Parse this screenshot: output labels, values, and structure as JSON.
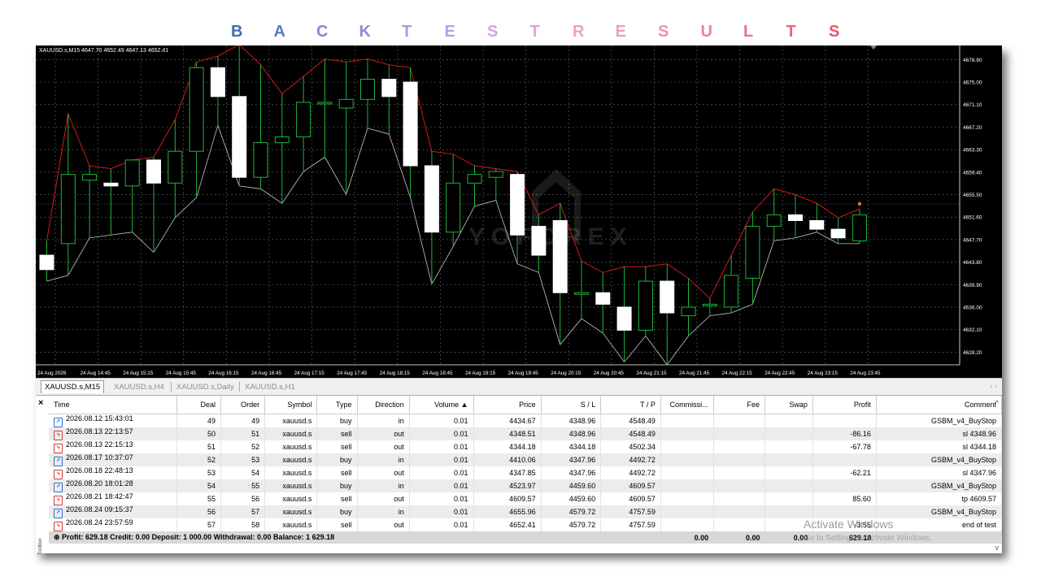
{
  "banner": {
    "letters": [
      "B",
      "A",
      "C",
      "K",
      "T",
      "E",
      "S",
      "T",
      "R",
      "E",
      "S",
      "U",
      "L",
      "T",
      "S"
    ],
    "colors": [
      "#3f6fb3",
      "#5a7bc4",
      "#7a8fd0",
      "#8b8bd8",
      "#a59be0",
      "#b69ee0",
      "#d3a3e6",
      "#e1a3d8",
      "#e8a3c8",
      "#ed9eb8",
      "#ef93aa",
      "#ee8294",
      "#ed7086",
      "#ec6178",
      "#e8566e"
    ]
  },
  "chart": {
    "header": "XAUUSD.s,M15  4647.70 4652.49 4647.13 4652.41",
    "watermark": "YOFOREX",
    "price_labels": [
      "4678.90",
      "4675.00",
      "4671.10",
      "4667.20",
      "4663.30",
      "4659.40",
      "4655.50",
      "4651.60",
      "4647.70",
      "4643.80",
      "4639.90",
      "4636.00",
      "4632.10",
      "4628.20"
    ],
    "time_labels": [
      "24 Aug 2026",
      "24 Aug 14:45",
      "24 Aug 15:15",
      "24 Aug 15:45",
      "24 Aug 16:15",
      "24 Aug 16:45",
      "24 Aug 17:15",
      "24 Aug 17:45",
      "24 Aug 18:15",
      "24 Aug 18:45",
      "24 Aug 19:15",
      "24 Aug 19:45",
      "24 Aug 20:15",
      "24 Aug 20:45",
      "24 Aug 21:15",
      "24 Aug 21:45",
      "24 Aug 22:15",
      "24 Aug 22:45",
      "24 Aug 23:15",
      "24 Aug 23:45"
    ],
    "candles": [
      {
        "o": 4645.0,
        "c": 4642.5,
        "h": 4647.5,
        "l": 4640.5
      },
      {
        "o": 4647.0,
        "c": 4659.0,
        "h": 4669.5,
        "l": 4641.5
      },
      {
        "o": 4658.0,
        "c": 4659.0,
        "h": 4660.5,
        "l": 4648.0
      },
      {
        "o": 4657.5,
        "c": 4657.0,
        "h": 4660.0,
        "l": 4648.5
      },
      {
        "o": 4657.0,
        "c": 4661.5,
        "h": 4661.5,
        "l": 4649.0
      },
      {
        "o": 4661.5,
        "c": 4657.5,
        "h": 4662.0,
        "l": 4645.5
      },
      {
        "o": 4657.5,
        "c": 4663.0,
        "h": 4668.5,
        "l": 4651.5
      },
      {
        "o": 4663.0,
        "c": 4677.5,
        "h": 4678.5,
        "l": 4655.0
      },
      {
        "o": 4677.5,
        "c": 4672.5,
        "h": 4679.5,
        "l": 4667.5
      },
      {
        "o": 4672.5,
        "c": 4658.5,
        "h": 4681.5,
        "l": 4657.0
      },
      {
        "o": 4658.5,
        "c": 4664.5,
        "h": 4678.0,
        "l": 4656.5
      },
      {
        "o": 4664.5,
        "c": 4665.5,
        "h": 4673.0,
        "l": 4654.0
      },
      {
        "o": 4665.5,
        "c": 4671.5,
        "h": 4676.0,
        "l": 4659.5
      },
      {
        "o": 4671.5,
        "c": 4671.5,
        "h": 4679.0,
        "l": 4662.0
      },
      {
        "o": 4670.5,
        "c": 4672.0,
        "h": 4678.5,
        "l": 4655.5
      },
      {
        "o": 4672.0,
        "c": 4675.5,
        "h": 4679.0,
        "l": 4667.0
      },
      {
        "o": 4675.5,
        "c": 4672.5,
        "h": 4678.0,
        "l": 4666.0
      },
      {
        "o": 4675.0,
        "c": 4660.5,
        "h": 4677.5,
        "l": 4655.0
      },
      {
        "o": 4660.5,
        "c": 4649.0,
        "h": 4663.0,
        "l": 4640.0
      },
      {
        "o": 4649.0,
        "c": 4657.5,
        "h": 4662.5,
        "l": 4646.5
      },
      {
        "o": 4657.5,
        "c": 4659.0,
        "h": 4660.5,
        "l": 4653.5
      },
      {
        "o": 4658.5,
        "c": 4659.5,
        "h": 4660.0,
        "l": 4654.5
      },
      {
        "o": 4659.0,
        "c": 4648.5,
        "h": 4659.5,
        "l": 4643.5
      },
      {
        "o": 4650.0,
        "c": 4645.0,
        "h": 4652.0,
        "l": 4642.0
      },
      {
        "o": 4651.0,
        "c": 4638.5,
        "h": 4654.0,
        "l": 4629.5
      },
      {
        "o": 4638.5,
        "c": 4638.5,
        "h": 4644.0,
        "l": 4634.0
      },
      {
        "o": 4638.5,
        "c": 4636.5,
        "h": 4642.0,
        "l": 4631.5
      },
      {
        "o": 4636.0,
        "c": 4632.0,
        "h": 4643.0,
        "l": 4626.5
      },
      {
        "o": 4632.0,
        "c": 4640.5,
        "h": 4643.0,
        "l": 4631.0
      },
      {
        "o": 4640.5,
        "c": 4635.0,
        "h": 4643.5,
        "l": 4626.0
      },
      {
        "o": 4634.5,
        "c": 4636.0,
        "h": 4641.0,
        "l": 4631.0
      },
      {
        "o": 4636.5,
        "c": 4636.5,
        "h": 4637.5,
        "l": 4634.5
      },
      {
        "o": 4636.0,
        "c": 4641.5,
        "h": 4645.0,
        "l": 4635.0
      },
      {
        "o": 4641.0,
        "c": 4650.0,
        "h": 4652.5,
        "l": 4636.5
      },
      {
        "o": 4650.0,
        "c": 4652.0,
        "h": 4656.5,
        "l": 4647.5
      },
      {
        "o": 4652.0,
        "c": 4651.0,
        "h": 4655.5,
        "l": 4648.0
      },
      {
        "o": 4651.0,
        "c": 4649.5,
        "h": 4654.0,
        "l": 4649.0
      },
      {
        "o": 4649.5,
        "c": 4648.0,
        "h": 4651.5,
        "l": 4647.0
      },
      {
        "o": 4647.5,
        "c": 4652.0,
        "h": 4653.0,
        "l": 4647.0
      }
    ]
  },
  "tabs": [
    "XAUUSD.s,M15",
    "XAUUSD.s,H4",
    "XAUUSD.s,Daily",
    "XAUUSD.s,H1"
  ],
  "table": {
    "columns": [
      "Time",
      "Deal",
      "Order",
      "Symbol",
      "Type",
      "Direction",
      "Volume ▲",
      "Price",
      "S / L",
      "T / P",
      "Commissi...",
      "Fee",
      "Swap",
      "Profit",
      "Comment"
    ],
    "rows": [
      {
        "type_icon": "buy",
        "time": "2026.08.12 15:43:01",
        "deal": "49",
        "order": "49",
        "symbol": "xauusd.s",
        "type": "buy",
        "direction": "in",
        "volume": "0.01",
        "price": "4434.67",
        "sl": "4348.96",
        "tp": "4548.49",
        "commission": "",
        "fee": "",
        "swap": "",
        "profit": "",
        "comment": "GSBM_v4_BuyStop"
      },
      {
        "type_icon": "sell",
        "time": "2026.08.13 22:13:57",
        "deal": "50",
        "order": "51",
        "symbol": "xauusd.s",
        "type": "sell",
        "direction": "out",
        "volume": "0.01",
        "price": "4348.51",
        "sl": "4348.96",
        "tp": "4548.49",
        "commission": "",
        "fee": "",
        "swap": "",
        "profit": "-86.16",
        "comment": "sl 4348.96"
      },
      {
        "type_icon": "sell",
        "time": "2026.08.13 22:15:13",
        "deal": "51",
        "order": "52",
        "symbol": "xauusd.s",
        "type": "sell",
        "direction": "out",
        "volume": "0.01",
        "price": "4344.18",
        "sl": "4344.18",
        "tp": "4502.34",
        "commission": "",
        "fee": "",
        "swap": "",
        "profit": "-67.78",
        "comment": "sl 4344.18"
      },
      {
        "type_icon": "buy",
        "time": "2026.08.17 10:37:07",
        "deal": "52",
        "order": "53",
        "symbol": "xauusd.s",
        "type": "buy",
        "direction": "in",
        "volume": "0.01",
        "price": "4410.06",
        "sl": "4347.96",
        "tp": "4492.72",
        "commission": "",
        "fee": "",
        "swap": "",
        "profit": "",
        "comment": "GSBM_v4_BuyStop"
      },
      {
        "type_icon": "sell",
        "time": "2026.08.18 22:48:13",
        "deal": "53",
        "order": "54",
        "symbol": "xauusd.s",
        "type": "sell",
        "direction": "out",
        "volume": "0.01",
        "price": "4347.85",
        "sl": "4347.96",
        "tp": "4492.72",
        "commission": "",
        "fee": "",
        "swap": "",
        "profit": "-62.21",
        "comment": "sl 4347.96"
      },
      {
        "type_icon": "buy",
        "time": "2026.08.20 18:01:28",
        "deal": "54",
        "order": "55",
        "symbol": "xauusd.s",
        "type": "buy",
        "direction": "in",
        "volume": "0.01",
        "price": "4523.97",
        "sl": "4459.60",
        "tp": "4609.57",
        "commission": "",
        "fee": "",
        "swap": "",
        "profit": "",
        "comment": "GSBM_v4_BuyStop"
      },
      {
        "type_icon": "sell",
        "time": "2026.08.21 18:42:47",
        "deal": "55",
        "order": "56",
        "symbol": "xauusd.s",
        "type": "sell",
        "direction": "out",
        "volume": "0.01",
        "price": "4609.57",
        "sl": "4459.60",
        "tp": "4609.57",
        "commission": "",
        "fee": "",
        "swap": "",
        "profit": "85.60",
        "comment": "tp 4609.57"
      },
      {
        "type_icon": "buy",
        "time": "2026.08.24 09:15:37",
        "deal": "56",
        "order": "57",
        "symbol": "xauusd.s",
        "type": "buy",
        "direction": "in",
        "volume": "0.01",
        "price": "4655.96",
        "sl": "4579.72",
        "tp": "4757.59",
        "commission": "",
        "fee": "",
        "swap": "",
        "profit": "",
        "comment": "GSBM_v4_BuyStop"
      },
      {
        "type_icon": "sell",
        "time": "2026.08.24 23:57:59",
        "deal": "57",
        "order": "58",
        "symbol": "xauusd.s",
        "type": "sell",
        "direction": "out",
        "volume": "0.01",
        "price": "4652.41",
        "sl": "4579.72",
        "tp": "4757.59",
        "commission": "",
        "fee": "",
        "swap": "",
        "profit": "-3.55",
        "comment": "end of test"
      }
    ],
    "summary": {
      "text": "Profit: 629.18  Credit: 0.00  Deposit: 1 000.00  Withdrawal: 0.00  Balance: 1 629.18",
      "commission": "0.00",
      "fee": "0.00",
      "swap": "0.00",
      "profit": "629.18"
    }
  },
  "side_label": "Toolbox",
  "activate": {
    "title": "Activate Windows",
    "subtitle": "Go to Settings to activate Windows."
  }
}
